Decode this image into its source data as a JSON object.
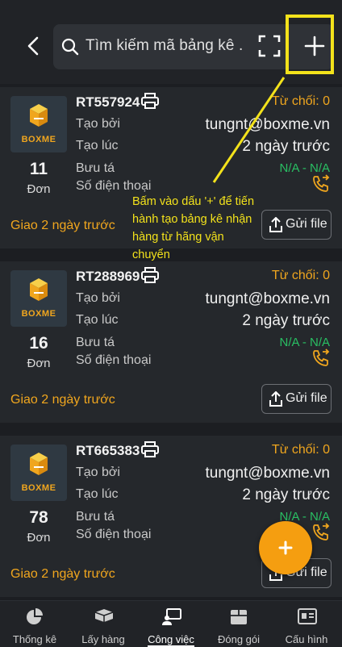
{
  "header": {
    "search_placeholder": "Tìm kiếm mã bảng kê ."
  },
  "cards": [
    {
      "brand": "BOXME",
      "code": "RT557924",
      "rejected": "Từ chối:  0",
      "created_by_label": "Tạo bởi",
      "created_by": "tungnt@boxme.vn",
      "created_at_label": "Tạo lúc",
      "created_at": "2 ngày trước",
      "postman_label": "Bưu tá",
      "phone_label": "Số điện thoại",
      "postman_value": "N/A - N/A",
      "count": "11",
      "count_unit": "Đơn",
      "delivery": "Giao  2 ngày trước",
      "send_file": "Gửi file"
    },
    {
      "brand": "BOXME",
      "code": "RT288969",
      "rejected": "Từ chối:  0",
      "created_by_label": "Tạo bởi",
      "created_by": "tungnt@boxme.vn",
      "created_at_label": "Tạo lúc",
      "created_at": "2 ngày trước",
      "postman_label": "Bưu tá",
      "phone_label": "Số điện thoại",
      "postman_value": "N/A - N/A",
      "count": "16",
      "count_unit": "Đơn",
      "delivery": "Giao  2 ngày trước",
      "send_file": "Gửi file"
    },
    {
      "brand": "BOXME",
      "code": "RT665383",
      "rejected": "Từ chối:  0",
      "created_by_label": "Tạo bởi",
      "created_by": "tungnt@boxme.vn",
      "created_at_label": "Tạo lúc",
      "created_at": "2 ngày trước",
      "postman_label": "Bưu tá",
      "phone_label": "Số điện thoại",
      "postman_value": "N/A - N/A",
      "count": "78",
      "count_unit": "Đơn",
      "delivery": "Giao  2 ngày trước",
      "send_file": "Gửi file"
    }
  ],
  "annotation": {
    "text": "Bấm vào dấu '+' để tiến hành tạo bảng kê nhận hàng từ hãng vận chuyển"
  },
  "nav": [
    {
      "label": "Thống kê",
      "icon": "pie-chart-icon"
    },
    {
      "label": "Lấy hàng",
      "icon": "truck-box-icon"
    },
    {
      "label": "Công việc",
      "icon": "task-icon"
    },
    {
      "label": "Đóng gói",
      "icon": "package-icon"
    },
    {
      "label": "Cấu hình",
      "icon": "id-card-icon"
    }
  ],
  "colors": {
    "accent": "#f0a61e",
    "success": "#29bf63",
    "highlight": "#f3e21b",
    "background": "#1c1e22",
    "card": "#25282c"
  }
}
